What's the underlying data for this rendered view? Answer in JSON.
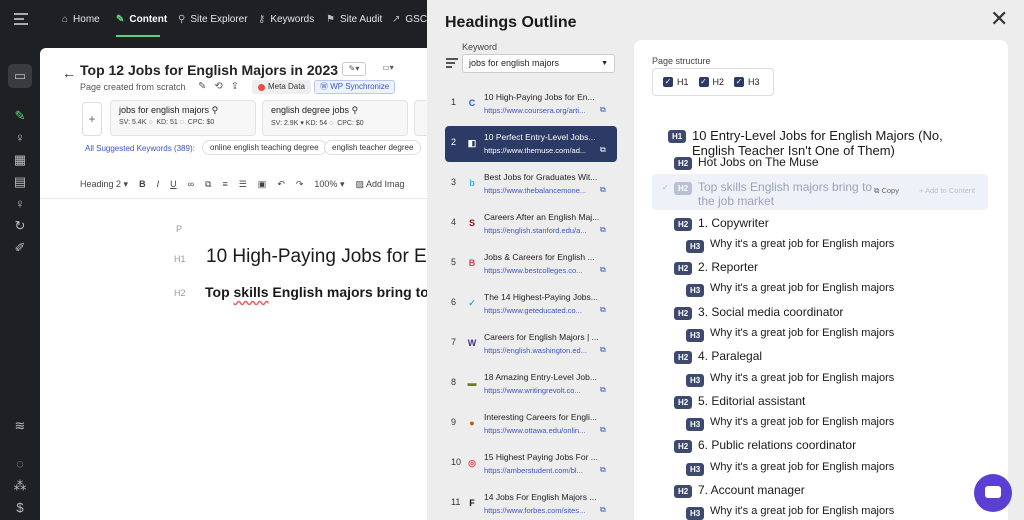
{
  "nav": {
    "items": [
      {
        "label": "Home",
        "icon": "home-icon"
      },
      {
        "label": "Content",
        "icon": "pencil-icon",
        "active": true
      },
      {
        "label": "Site Explorer",
        "icon": "search-icon"
      },
      {
        "label": "Keywords",
        "icon": "key-icon"
      },
      {
        "label": "Site Audit",
        "icon": "audit-icon"
      },
      {
        "label": "GSC I",
        "icon": "gsc-icon"
      }
    ],
    "accent": "#5fd07a"
  },
  "editor": {
    "title": "Top 12 Jobs for English Majors in 2023",
    "subtitle": "Page created from scratch",
    "meta_label": "Meta Data",
    "wp_label": "WP Synchronize",
    "keywords": [
      {
        "name": "jobs for english majors",
        "sv": "SV: 5.4K",
        "kd": "KD: 51",
        "cpc": "CPC: $0"
      },
      {
        "name": "english degree jobs",
        "sv": "SV: 2.9K",
        "kd": "KD: 54",
        "cpc": "CPC: $0"
      }
    ],
    "all_suggested": "All Suggested Keywords (389):",
    "pills": [
      "online english teaching degree",
      "english teacher degree"
    ],
    "toolbar": {
      "heading": "Heading 2",
      "zoom": "100%",
      "add_image": "Add Imag"
    },
    "tags": {
      "p": "P",
      "h1": "H1",
      "h2": "H2"
    },
    "h1_text": "10 High-Paying Jobs for E",
    "h2_text_a": "Top ",
    "h2_text_b": "skills",
    "h2_text_c": " English majors bring to"
  },
  "outline": {
    "title": "Headings Outline",
    "keyword_label": "Keyword",
    "keyword_value": "jobs for english majors",
    "results": [
      {
        "num": "1",
        "title": "10 High-Paying Jobs for En...",
        "url": "https://www.coursera.org/arti...",
        "fav": "C",
        "color": "#2a5bd7"
      },
      {
        "num": "2",
        "title": "10 Perfect Entry-Level Jobs...",
        "url": "https://www.themuse.com/ad...",
        "fav": "◧",
        "color": "#ffffff",
        "active": true
      },
      {
        "num": "3",
        "title": "Best Jobs for Graduates Wit...",
        "url": "https://www.thebalancemone...",
        "fav": "b",
        "color": "#3ab0e8"
      },
      {
        "num": "4",
        "title": "Careers After an English Maj...",
        "url": "https://english.stanford.edu/a...",
        "fav": "S",
        "color": "#8c1515"
      },
      {
        "num": "5",
        "title": "Jobs & Careers for English ...",
        "url": "https://www.bestcolleges.co...",
        "fav": "B",
        "color": "#e0404a"
      },
      {
        "num": "6",
        "title": "The 14 Highest-Paying Jobs...",
        "url": "https://www.geteducated.co...",
        "fav": "✓",
        "color": "#3aa0d8"
      },
      {
        "num": "7",
        "title": "Careers for English Majors | ...",
        "url": "https://english.washington.ed...",
        "fav": "W",
        "color": "#4b2e83"
      },
      {
        "num": "8",
        "title": "18 Amazing Entry-Level Job...",
        "url": "https://www.writingrevolt.co...",
        "fav": "▬",
        "color": "#6a7a2a"
      },
      {
        "num": "9",
        "title": "Interesting Careers for Engli...",
        "url": "https://www.ottawa.edu/onlin...",
        "fav": "●",
        "color": "#c05a1a"
      },
      {
        "num": "10",
        "title": "15 Highest Paying Jobs For ...",
        "url": "https://amberstudent.com/bl...",
        "fav": "◎",
        "color": "#e04848"
      },
      {
        "num": "11",
        "title": "14 Jobs For English Majors ...",
        "url": "https://www.forbes.com/sites...",
        "fav": "F",
        "color": "#111111"
      }
    ],
    "page_structure_label": "Page structure",
    "checks": [
      "H1",
      "H2",
      "H3"
    ],
    "copy_label": "Copy",
    "add_label": "+ Add to Content",
    "headings": [
      {
        "level": "H1",
        "text": "10 Entry-Level Jobs for English Majors (No,",
        "text2": "English Teacher Isn't One of Them)"
      },
      {
        "level": "H2",
        "text": "Hot Jobs on The Muse"
      },
      {
        "level": "H2",
        "text": "Top skills English majors bring to",
        "text2": "the job market",
        "highlight": true
      },
      {
        "level": "H2",
        "text": "1. Copywriter"
      },
      {
        "level": "H3",
        "text": "Why it's a great job for English majors"
      },
      {
        "level": "H2",
        "text": "2. Reporter"
      },
      {
        "level": "H3",
        "text": "Why it's a great job for English majors"
      },
      {
        "level": "H2",
        "text": "3. Social media coordinator"
      },
      {
        "level": "H3",
        "text": "Why it's a great job for English majors"
      },
      {
        "level": "H2",
        "text": "4. Paralegal"
      },
      {
        "level": "H3",
        "text": "Why it's a great job for English majors"
      },
      {
        "level": "H2",
        "text": "5. Editorial assistant"
      },
      {
        "level": "H3",
        "text": "Why it's a great job for English majors"
      },
      {
        "level": "H2",
        "text": "6. Public relations coordinator"
      },
      {
        "level": "H3",
        "text": "Why it's a great job for English majors"
      },
      {
        "level": "H2",
        "text": "7. Account manager"
      },
      {
        "level": "H3",
        "text": "Why it's a great job for English majors"
      }
    ],
    "highlight_color": "#eef1f8",
    "badge_color": "#3d4a6e"
  }
}
